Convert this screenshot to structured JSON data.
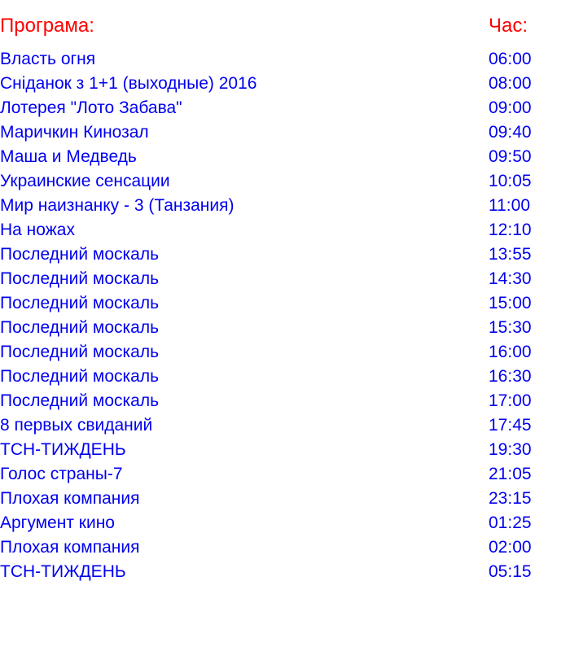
{
  "header": {
    "program_label": "Програма:",
    "time_label": "Час:"
  },
  "schedule": [
    {
      "program": "Власть огня",
      "time": "06:00"
    },
    {
      "program": "Сніданок з 1+1 (выходные) 2016",
      "time": "08:00"
    },
    {
      "program": "Лотерея \"Лото Забава\"",
      "time": "09:00"
    },
    {
      "program": "Маричкин Кинозал",
      "time": "09:40"
    },
    {
      "program": "Маша и Медведь",
      "time": "09:50"
    },
    {
      "program": "Украинские сенсации",
      "time": "10:05"
    },
    {
      "program": "Мир наизнанку - 3 (Танзания)",
      "time": "11:00"
    },
    {
      "program": "На ножах",
      "time": "12:10"
    },
    {
      "program": "Последний москаль",
      "time": "13:55"
    },
    {
      "program": "Последний москаль",
      "time": "14:30"
    },
    {
      "program": "Последний москаль",
      "time": "15:00"
    },
    {
      "program": "Последний москаль",
      "time": "15:30"
    },
    {
      "program": "Последний москаль",
      "time": "16:00"
    },
    {
      "program": "Последний москаль",
      "time": "16:30"
    },
    {
      "program": "Последний москаль",
      "time": "17:00"
    },
    {
      "program": "8 первых свиданий",
      "time": "17:45"
    },
    {
      "program": "ТСН-ТИЖДЕНЬ",
      "time": "19:30"
    },
    {
      "program": "Голос страны-7",
      "time": "21:05"
    },
    {
      "program": "Плохая компания",
      "time": "23:15"
    },
    {
      "program": "Аргумент кино",
      "time": "01:25"
    },
    {
      "program": "Плохая компания",
      "time": "02:00"
    },
    {
      "program": "ТСН-ТИЖДЕНЬ",
      "time": "05:15"
    }
  ],
  "colors": {
    "header": "#ff0000",
    "rows": "#0000ee"
  }
}
